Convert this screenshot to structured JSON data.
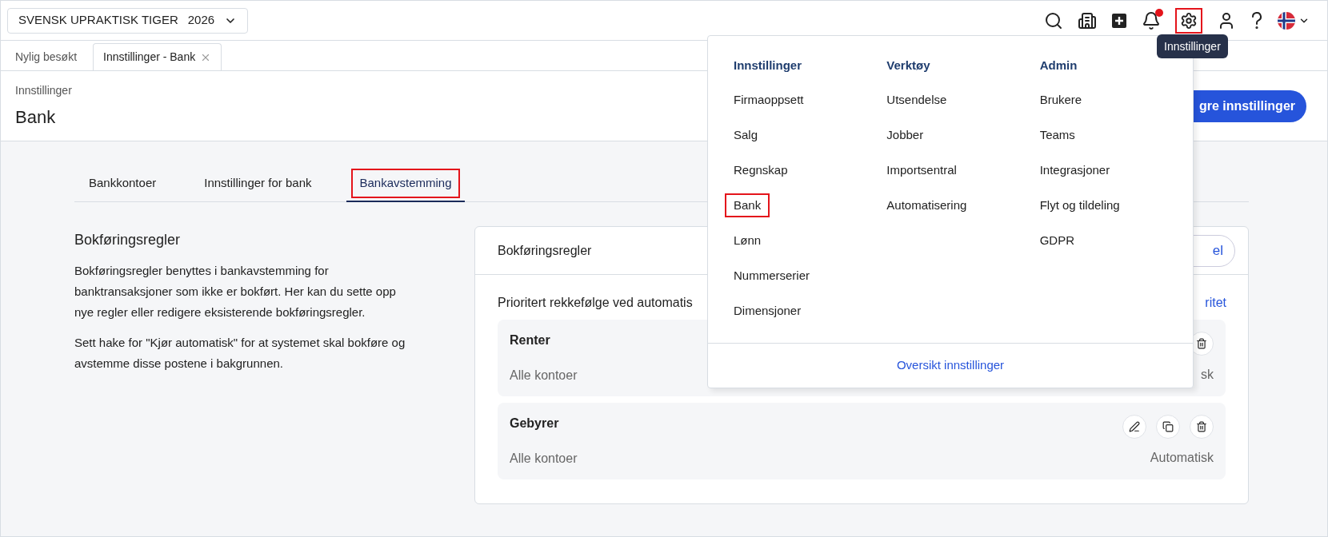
{
  "company_selector": {
    "name": "SVENSK UPRAKTISK TIGER",
    "year": "2026"
  },
  "notifications": {
    "unread": true
  },
  "settings_button": {
    "highlighted": true
  },
  "tooltip": "Innstillinger",
  "page_tabs": [
    {
      "label": "Nylig besøkt",
      "selected": false,
      "closable": false
    },
    {
      "label": "Innstillinger - Bank",
      "selected": true,
      "closable": true
    }
  ],
  "header": {
    "breadcrumb": "Innstillinger",
    "title": "Bank",
    "primary_button": "gre innstillinger"
  },
  "section_tabs": [
    {
      "label": "Bankkontoer",
      "selected": false,
      "highlighted": false
    },
    {
      "label": "Innstillinger for bank",
      "selected": false,
      "highlighted": false
    },
    {
      "label": "Bankavstemming",
      "selected": true,
      "highlighted": true
    }
  ],
  "intro": {
    "title": "Bokføringsregler",
    "paragraphs": [
      "Bokføringsregler benyttes i bankavstemming for banktransaksjoner som ikke er bokført. Her kan du sette opp nye regler eller redigere eksisterende bokføringsregler.",
      "Sett hake for \"Kjør automatisk\" for at systemet skal bokføre og avstemme disse postene i bakgrunnen."
    ]
  },
  "card": {
    "title": "Bokføringsregler",
    "header_button": "el",
    "priority_text": "Prioritert rekkefølge ved automatis",
    "priority_link": "ritet",
    "rules": [
      {
        "name": "Renter",
        "accounts": "Alle kontoer",
        "mode": "sk",
        "actions": [
          {
            "kind": "delete"
          }
        ]
      },
      {
        "name": "Gebyrer",
        "accounts": "Alle kontoer",
        "mode": "Automatisk",
        "actions": [
          {
            "kind": "edit"
          },
          {
            "kind": "copy"
          },
          {
            "kind": "delete"
          }
        ]
      }
    ]
  },
  "menu": {
    "columns": [
      {
        "heading": "Innstillinger",
        "items": [
          {
            "label": "Firmaoppsett",
            "highlighted": false
          },
          {
            "label": "Salg",
            "highlighted": false
          },
          {
            "label": "Regnskap",
            "highlighted": false
          },
          {
            "label": "Bank",
            "highlighted": true
          },
          {
            "label": "Lønn",
            "highlighted": false
          },
          {
            "label": "Nummerserier",
            "highlighted": false
          },
          {
            "label": "Dimensjoner",
            "highlighted": false
          }
        ]
      },
      {
        "heading": "Verktøy",
        "items": [
          {
            "label": "Utsendelse",
            "highlighted": false
          },
          {
            "label": "Jobber",
            "highlighted": false
          },
          {
            "label": "Importsentral",
            "highlighted": false
          },
          {
            "label": "Automatisering",
            "highlighted": false
          }
        ]
      },
      {
        "heading": "Admin",
        "items": [
          {
            "label": "Brukere",
            "highlighted": false
          },
          {
            "label": "Teams",
            "highlighted": false
          },
          {
            "label": "Integrasjoner",
            "highlighted": false
          },
          {
            "label": "Flyt og tildeling",
            "highlighted": false
          },
          {
            "label": "GDPR",
            "highlighted": false
          }
        ]
      }
    ],
    "footer_link": "Oversikt innstillinger"
  }
}
